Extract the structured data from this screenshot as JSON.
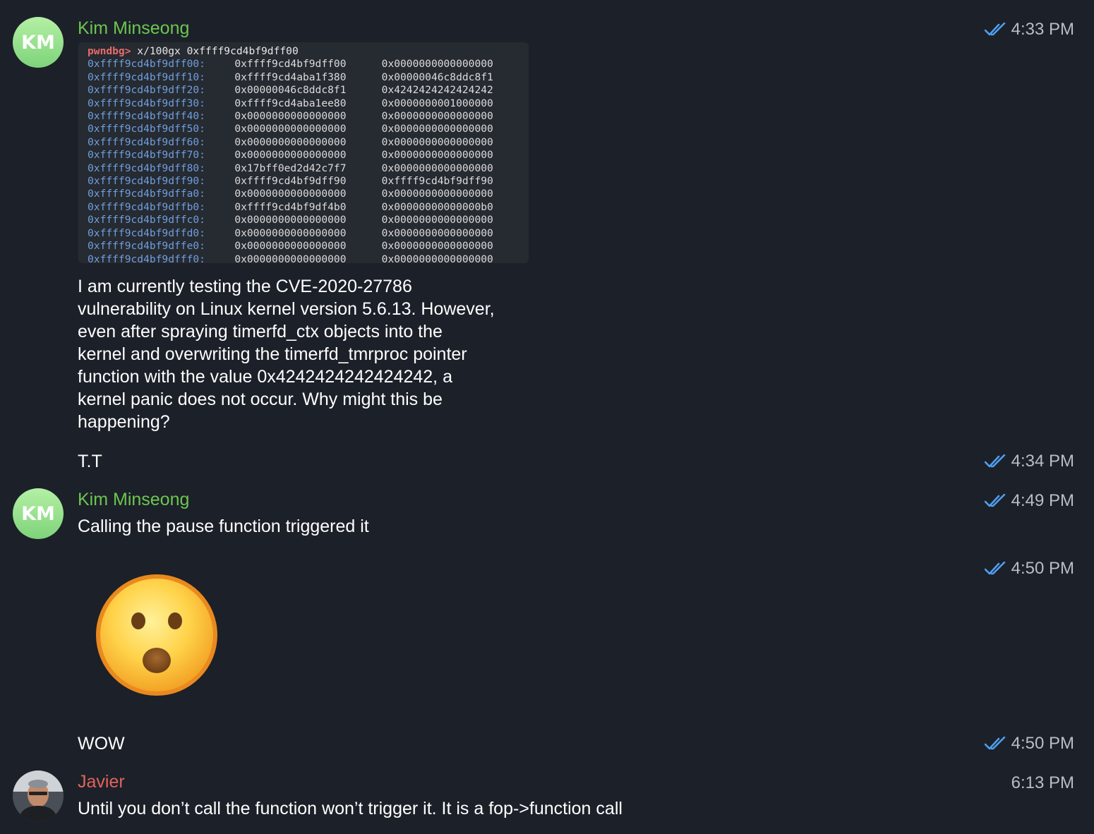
{
  "messages": {
    "m1": {
      "sender": "Kim Minseong",
      "avatar_initials": "KM",
      "time": "4:33 PM",
      "code": {
        "prompt": "pwndbg>",
        "command": " x/100gx 0xffff9cd4bf9dff00",
        "rows": [
          [
            "0xffff9cd4bf9dff00:",
            "0xffff9cd4bf9dff00",
            "0x0000000000000000"
          ],
          [
            "0xffff9cd4bf9dff10:",
            "0xffff9cd4aba1f380",
            "0x00000046c8ddc8f1"
          ],
          [
            "0xffff9cd4bf9dff20:",
            "0x00000046c8ddc8f1",
            "0x4242424242424242"
          ],
          [
            "0xffff9cd4bf9dff30:",
            "0xffff9cd4aba1ee80",
            "0x0000000001000000"
          ],
          [
            "0xffff9cd4bf9dff40:",
            "0x0000000000000000",
            "0x0000000000000000"
          ],
          [
            "0xffff9cd4bf9dff50:",
            "0x0000000000000000",
            "0x0000000000000000"
          ],
          [
            "0xffff9cd4bf9dff60:",
            "0x0000000000000000",
            "0x0000000000000000"
          ],
          [
            "0xffff9cd4bf9dff70:",
            "0x0000000000000000",
            "0x0000000000000000"
          ],
          [
            "0xffff9cd4bf9dff80:",
            "0x17bff0ed2d42c7f7",
            "0x0000000000000000"
          ],
          [
            "0xffff9cd4bf9dff90:",
            "0xffff9cd4bf9dff90",
            "0xffff9cd4bf9dff90"
          ],
          [
            "0xffff9cd4bf9dffa0:",
            "0x0000000000000000",
            "0x0000000000000000"
          ],
          [
            "0xffff9cd4bf9dffb0:",
            "0xffff9cd4bf9df4b0",
            "0x00000000000000b0"
          ],
          [
            "0xffff9cd4bf9dffc0:",
            "0x0000000000000000",
            "0x0000000000000000"
          ],
          [
            "0xffff9cd4bf9dffd0:",
            "0x0000000000000000",
            "0x0000000000000000"
          ],
          [
            "0xffff9cd4bf9dffe0:",
            "0x0000000000000000",
            "0x0000000000000000"
          ],
          [
            "0xffff9cd4bf9dfff0:",
            "0x0000000000000000",
            "0x0000000000000000"
          ]
        ]
      },
      "text_lines": [
        "I am currently testing the CVE-2020-27786",
        "vulnerability on Linux kernel version 5.6.13. However,",
        "even after spraying timerfd_ctx objects into the",
        "kernel and overwriting the timerfd_tmrproc pointer",
        "function with the value 0x4242424242424242, a",
        "kernel panic does not occur. Why might this be",
        "happening?"
      ]
    },
    "m2": {
      "text": "T.T",
      "time": "4:34 PM"
    },
    "m3": {
      "sender": "Kim Minseong",
      "avatar_initials": "KM",
      "text": "Calling the pause function triggered it",
      "time": "4:49 PM"
    },
    "m4": {
      "emoji": "astonished-face",
      "time": "4:50 PM"
    },
    "m5": {
      "text": "WOW",
      "time": "4:50 PM"
    },
    "m6": {
      "sender": "Javier",
      "text": "Until you don’t call the function won’t trigger it. It is a fop->function call",
      "time": "6:13 PM"
    }
  },
  "colors": {
    "background": "#1c2029",
    "sender_kim": "#6cc64f",
    "sender_javier": "#e0645a",
    "read_check": "#4f9ff0",
    "timestamp": "#b9bec6"
  }
}
